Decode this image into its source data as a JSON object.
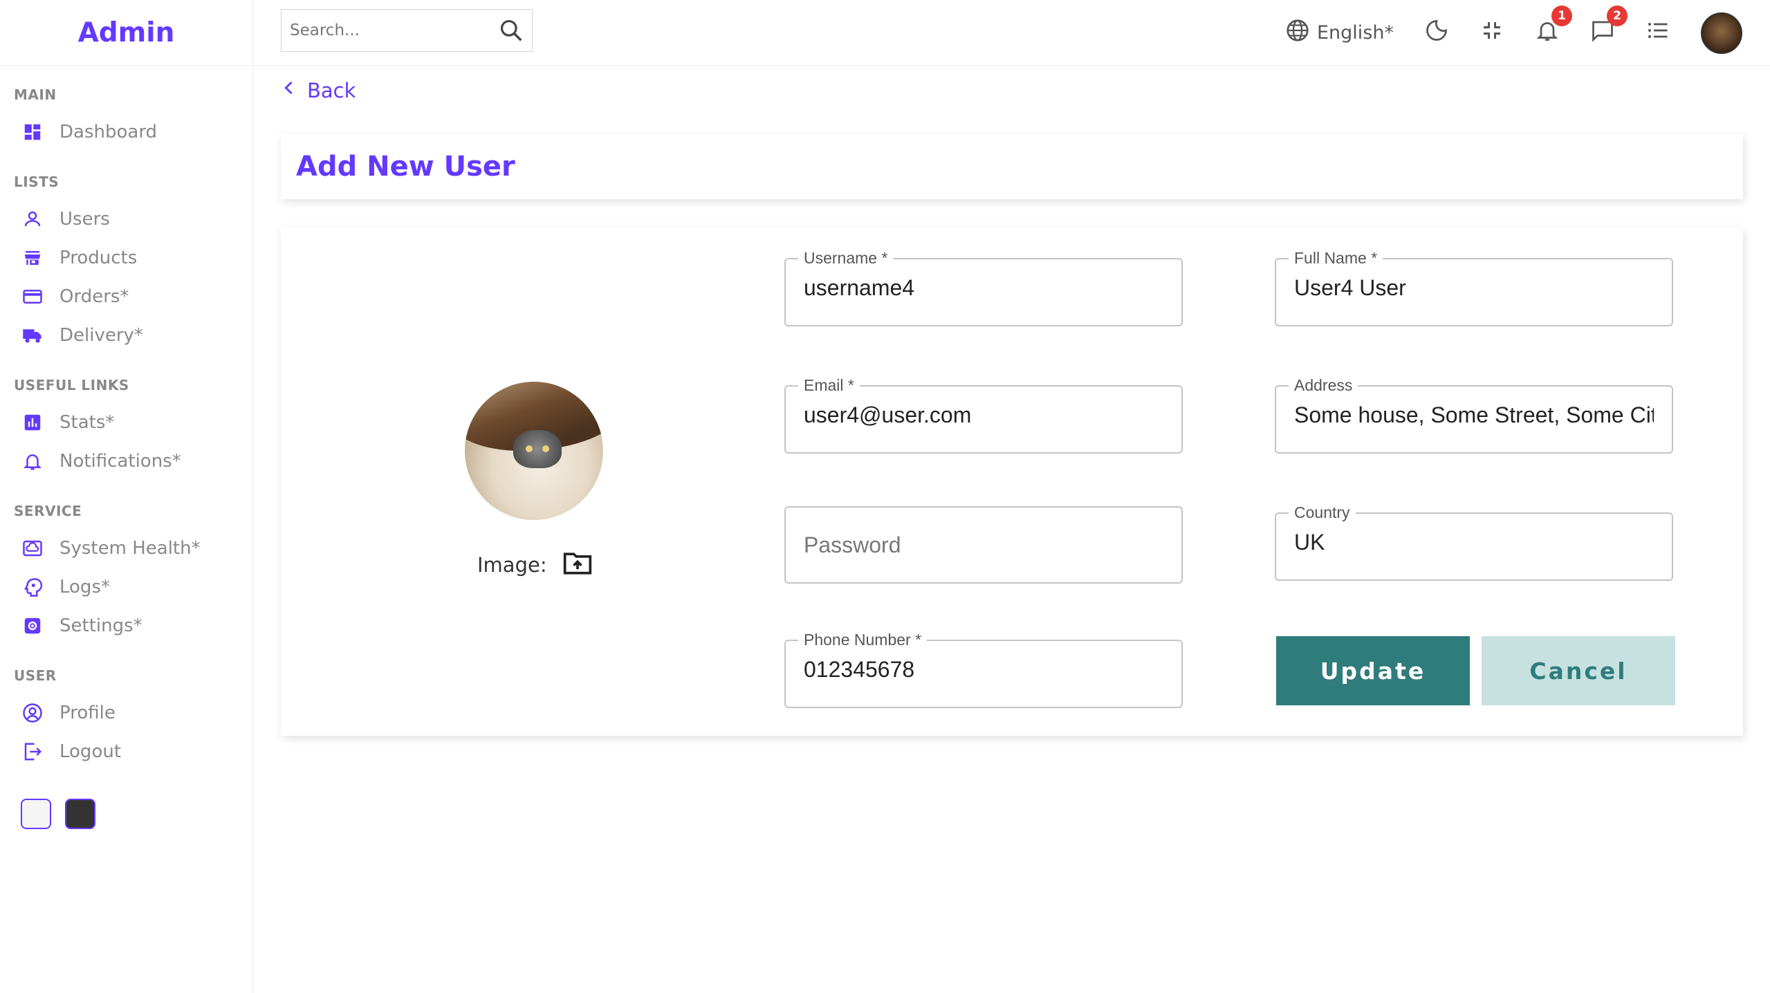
{
  "app": {
    "title": "Admin"
  },
  "sidebar": {
    "sections": {
      "main": "MAIN",
      "lists": "LISTS",
      "useful_links": "USEFUL LINKS",
      "service": "SERVICE",
      "user": "USER"
    },
    "items": {
      "dashboard": "Dashboard",
      "users": "Users",
      "products": "Products",
      "orders": "Orders*",
      "delivery": "Delivery*",
      "stats": "Stats*",
      "notifications": "Notifications*",
      "system_health": "System Health*",
      "logs": "Logs*",
      "settings": "Settings*",
      "profile": "Profile",
      "logout": "Logout"
    },
    "accent_color": "#6439ff"
  },
  "topbar": {
    "search_placeholder": "Search...",
    "language": "English*",
    "notifications_count": "1",
    "messages_count": "2"
  },
  "page": {
    "back_label": "Back",
    "title": "Add New User",
    "image_label": "Image:"
  },
  "form": {
    "username": {
      "label": "Username *",
      "value": "username4"
    },
    "full_name": {
      "label": "Full Name *",
      "value": "User4 User"
    },
    "email": {
      "label": "Email *",
      "value": "user4@user.com"
    },
    "address": {
      "label": "Address",
      "value": "Some house, Some Street, Some City"
    },
    "password": {
      "placeholder": "Password",
      "value": ""
    },
    "country": {
      "label": "Country",
      "value": "UK"
    },
    "phone": {
      "label": "Phone Number *",
      "value": "012345678"
    },
    "update_label": "Update",
    "cancel_label": "Cancel"
  },
  "colors": {
    "primary_button": "#2f7c7c",
    "secondary_button": "#c7e0e0",
    "badge": "#e53935"
  }
}
